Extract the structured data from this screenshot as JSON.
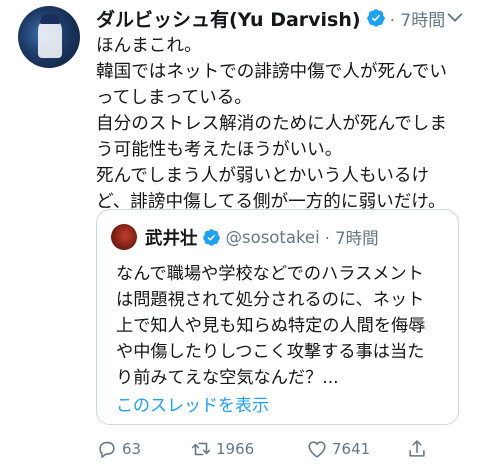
{
  "tweet": {
    "author_name": "ダルビッシュ有(Yu Darvish)",
    "time": "· 7時間",
    "lines": [
      "ほんまこれ。",
      "韓国ではネットでの誹謗中傷で人が死んでい",
      "ってしまっている。",
      "自分のストレス解消のために人が死んでしま",
      "う可能性も考えたほうがいい。",
      "死んでしまう人が弱いとかいう人もいるけ",
      "ど、誹謗中傷してる側が一方的に弱いだけ。"
    ]
  },
  "quoted": {
    "author_name": "武井壮",
    "handle": "@sosotakei",
    "time": "· 7時間",
    "lines": [
      "なんで職場や学校などでのハラスメント",
      "は問題視されて処分されるのに、ネット",
      "上で知人や見も知らぬ特定の人間を侮辱",
      "や中傷したりしつこく攻撃する事は当た",
      "り前みてえな空気なんだ？..."
    ],
    "thread_link": "このスレッドを表示"
  },
  "actions": {
    "reply_count": "63",
    "retweet_count": "1966",
    "like_count": "7641"
  },
  "colors": {
    "accent": "#1da1f2",
    "muted": "#657786",
    "border": "#ccd6dd"
  }
}
